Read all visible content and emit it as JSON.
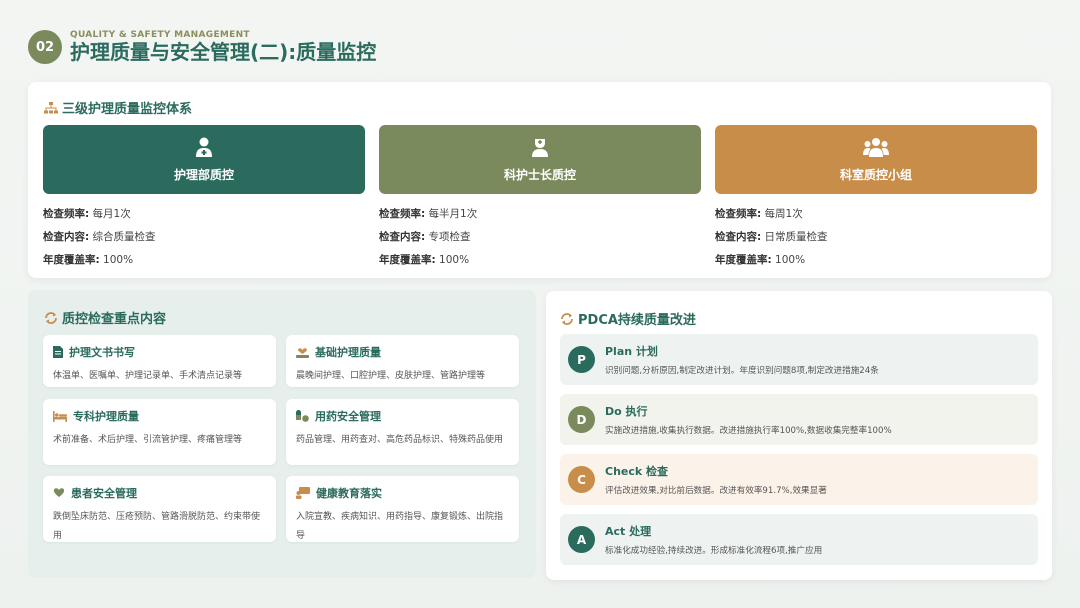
{
  "header": {
    "number": "02",
    "subtitle": "QUALITY & SAFETY MANAGEMENT",
    "title": "护理质量与安全管理(二):质量监控"
  },
  "colors": {
    "primary": "#2b6b5e",
    "olive": "#7a8a5c",
    "orange": "#c98d4a",
    "light_green_bg": "#e6efec"
  },
  "monitoring": {
    "title": "三级护理质量监控体系",
    "icon": "hierarchy-icon",
    "levels": [
      {
        "name": "护理部质控",
        "icon": "doctor-icon",
        "color": "#2b6b5e",
        "freq_label": "检查频率:",
        "freq": "每月1次",
        "content_label": "检查内容:",
        "content": "综合质量检查",
        "coverage_label": "年度覆盖率:",
        "coverage": "100%"
      },
      {
        "name": "科护士长质控",
        "icon": "nurse-icon",
        "color": "#7a8a5c",
        "freq_label": "检查频率:",
        "freq": "每半月1次",
        "content_label": "检查内容:",
        "content": "专项检查",
        "coverage_label": "年度覆盖率:",
        "coverage": "100%"
      },
      {
        "name": "科室质控小组",
        "icon": "group-icon",
        "color": "#c98d4a",
        "freq_label": "检查频率:",
        "freq": "每周1次",
        "content_label": "检查内容:",
        "content": "日常质量检查",
        "coverage_label": "年度覆盖率:",
        "coverage": "100%"
      }
    ]
  },
  "key_points": {
    "title": "质控检查重点内容",
    "icon": "refresh-icon",
    "items": [
      {
        "title": "护理文书书写",
        "icon": "document-icon",
        "desc": "体温单、医嘱单、护理记录单、手术清点记录等"
      },
      {
        "title": "基础护理质量",
        "icon": "care-icon",
        "desc": "晨晚间护理、口腔护理、皮肤护理、管路护理等"
      },
      {
        "title": "专科护理质量",
        "icon": "bed-icon",
        "desc": "术前准备、术后护理、引流管护理、疼痛管理等"
      },
      {
        "title": "用药安全管理",
        "icon": "pills-icon",
        "desc": "药品管理、用药查对、高危药品标识、特殊药品使用"
      },
      {
        "title": "患者安全管理",
        "icon": "heart-shield-icon",
        "desc": "跌倒坠床防范、压疮预防、管路滑脱防范、约束带使用"
      },
      {
        "title": "健康教育落实",
        "icon": "teaching-icon",
        "desc": "入院宣教、疾病知识、用药指导、康复锻炼、出院指导"
      }
    ]
  },
  "pdca": {
    "title": "PDCA持续质量改进",
    "icon": "refresh-icon",
    "steps": [
      {
        "letter": "P",
        "name": "Plan 计划",
        "desc": "识别问题,分析原因,制定改进计划。年度识别问题8项,制定改进措施24条",
        "color": "#2b6b5e",
        "bg": "#eef3f1"
      },
      {
        "letter": "D",
        "name": "Do 执行",
        "desc": "实施改进措施,收集执行数据。改进措施执行率100%,数据收集完整率100%",
        "color": "#7a8a5c",
        "bg": "#f1f3ec"
      },
      {
        "letter": "C",
        "name": "Check 检查",
        "desc": "评估改进效果,对比前后数据。改进有效率91.7%,效果显著",
        "color": "#c98d4a",
        "bg": "#fbf3ea"
      },
      {
        "letter": "A",
        "name": "Act 处理",
        "desc": "标准化成功经验,持续改进。形成标准化流程6项,推广应用",
        "color": "#2b6b5e",
        "bg": "#eef3f1"
      }
    ]
  }
}
